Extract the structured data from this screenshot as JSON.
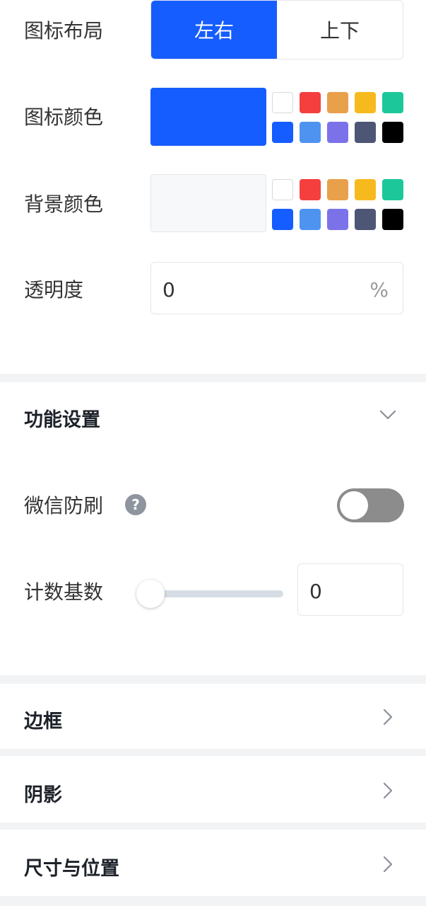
{
  "icon_layout": {
    "label": "图标布局",
    "options": [
      "左右",
      "上下"
    ],
    "selected": "左右"
  },
  "icon_color": {
    "label": "图标颜色",
    "value": "#165dff"
  },
  "bg_color": {
    "label": "背景颜色",
    "value": "#f7f8fa"
  },
  "palette": [
    "#ffffff",
    "#f53f3f",
    "#e8a04a",
    "#f7ba1e",
    "#1cc89a",
    "#165dff",
    "#4e93f0",
    "#7b72ea",
    "#4e5675",
    "#000000"
  ],
  "opacity": {
    "label": "透明度",
    "value": "0",
    "unit": "%"
  },
  "function_settings": {
    "title": "功能设置",
    "wechat_guard": {
      "label": "微信防刷",
      "help_icon": "?",
      "enabled": false
    },
    "count_base": {
      "label": "计数基数",
      "value": "0",
      "slider_fraction": 0
    }
  },
  "sections": {
    "border": "边框",
    "shadow": "阴影",
    "size_position": "尺寸与位置"
  }
}
